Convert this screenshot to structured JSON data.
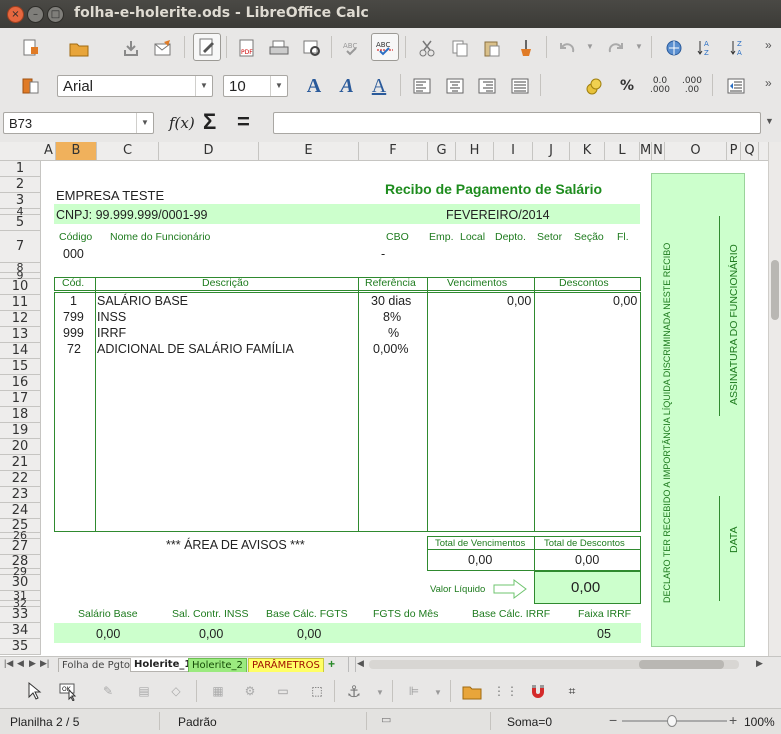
{
  "window": {
    "title": "folha-e-holerite.ods - LibreOffice Calc"
  },
  "format_bar": {
    "font_name": "Arial",
    "font_size": "10"
  },
  "formula_bar": {
    "cell_ref": "B73",
    "formula": ""
  },
  "grid": {
    "columns": [
      "A",
      "B",
      "C",
      "D",
      "E",
      "F",
      "G",
      "H",
      "I",
      "J",
      "K",
      "L",
      "M",
      "N",
      "O",
      "P",
      "Q"
    ],
    "selected_column": "B",
    "rows": [
      "1",
      "2",
      "3",
      "4",
      "5",
      "7",
      "8",
      "9",
      "10",
      "11",
      "12",
      "13",
      "14",
      "15",
      "16",
      "17",
      "18",
      "19",
      "20",
      "21",
      "22",
      "23",
      "24",
      "25",
      "26",
      "27",
      "28",
      "29",
      "30",
      "31",
      "32",
      "33",
      "34",
      "35"
    ]
  },
  "sheet": {
    "company": "EMPRESA TESTE",
    "title": "Recibo de Pagamento de Salário",
    "cnpj": "CNPJ: 99.999.999/0001-99",
    "period": "FEVEREIRO/2014",
    "hdr_codigo": "Código",
    "hdr_nome": "Nome do Funcionário",
    "hdr_cbo": "CBO",
    "hdr_emp": "Emp.",
    "hdr_local": "Local",
    "hdr_depto": "Depto.",
    "hdr_setor": "Setor",
    "hdr_secao": "Seção",
    "hdr_fl": "Fl.",
    "codigo_val": "000",
    "cbo_val": "-",
    "table_headers": {
      "cod": "Cód.",
      "desc": "Descrição",
      "ref": "Referência",
      "venc": "Vencimentos",
      "desc2": "Descontos"
    },
    "items": [
      {
        "cod": "1",
        "desc": "SALÁRIO BASE",
        "ref": "30 dias",
        "venc": "0,00",
        "descv": "0,00"
      },
      {
        "cod": "799",
        "desc": "INSS",
        "ref": "8%",
        "venc": "",
        "descv": ""
      },
      {
        "cod": "999",
        "desc": "IRRF",
        "ref": "%",
        "venc": "",
        "descv": ""
      },
      {
        "cod": "72",
        "desc": "ADICIONAL DE SALÁRIO FAMÍLIA",
        "ref": "0,00%",
        "venc": "",
        "descv": ""
      }
    ],
    "avisos": "*** ÁREA DE AVISOS ***",
    "total_venc_label": "Total de Vencimentos",
    "total_desc_label": "Total de Descontos",
    "total_venc": "0,00",
    "total_desc": "0,00",
    "liquido_label": "Valor Líquido",
    "liquido_val": "0,00",
    "footer_labels": [
      "Salário Base",
      "Sal. Contr. INSS",
      "Base Cálc. FGTS",
      "FGTS do Mês",
      "Base Cálc. IRRF",
      "Faixa IRRF"
    ],
    "footer_values": [
      "0,00",
      "0,00",
      "0,00",
      "",
      "",
      "05"
    ],
    "declaro": "DECLARO TER RECEBIDO A IMPORTÂNCIA LÍQUIDA DISCRIMINADA NESTE RECIBO",
    "assinatura": "ASSINATURA DO FUNCIONÁRIO",
    "data": "DATA"
  },
  "tabs": [
    "Folha de Pgto",
    "Holerite_1",
    "Holerite_2",
    "PARÂMETROS"
  ],
  "status": {
    "sheet": "Planilha 2 / 5",
    "style": "Padrão",
    "sum": "Soma=0",
    "zoom": "100%"
  },
  "colors": {
    "accent_green": "#2f8a2f",
    "light_green": "#ccffcc",
    "title_green": "#1e8c1e",
    "selected_col": "#f0b15c",
    "tab_yellow": "#ffff66"
  }
}
